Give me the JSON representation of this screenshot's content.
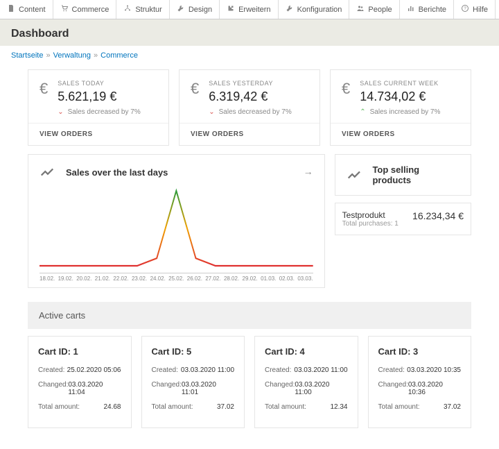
{
  "topnav": [
    {
      "icon": "doc",
      "label": "Content"
    },
    {
      "icon": "cart",
      "label": "Commerce"
    },
    {
      "icon": "tree",
      "label": "Struktur"
    },
    {
      "icon": "wrench",
      "label": "Design"
    },
    {
      "icon": "puzzle",
      "label": "Erweitern"
    },
    {
      "icon": "wrench",
      "label": "Konfiguration"
    },
    {
      "icon": "people",
      "label": "People"
    },
    {
      "icon": "bars",
      "label": "Berichte"
    },
    {
      "icon": "help",
      "label": "Hilfe"
    }
  ],
  "page_title": "Dashboard",
  "breadcrumb": [
    "Startseite",
    "Verwaltung",
    "Commerce"
  ],
  "stats": [
    {
      "label": "SALES TODAY",
      "value": "5.621,19 €",
      "delta_dir": "down",
      "delta_text": "Sales decreased by 7%",
      "footer": "VIEW ORDERS"
    },
    {
      "label": "SALES YESTERDAY",
      "value": "6.319,42 €",
      "delta_dir": "down",
      "delta_text": "Sales decreased by 7%",
      "footer": "VIEW ORDERS"
    },
    {
      "label": "SALES CURRENT WEEK",
      "value": "14.734,02 €",
      "delta_dir": "up",
      "delta_text": "Sales increased by 7%",
      "footer": "VIEW ORDERS"
    }
  ],
  "chart_title": "Sales over the last days",
  "products_title": "Top selling products",
  "products": [
    {
      "name": "Testprodukt",
      "sub": "Total purchases: 1",
      "price": "16.234,34 €"
    }
  ],
  "active_carts_title": "Active carts",
  "carts": [
    {
      "title": "Cart ID: 1",
      "created": "25.02.2020 05:06",
      "changed": "03.03.2020 11:04",
      "total": "24.68"
    },
    {
      "title": "Cart ID: 5",
      "created": "03.03.2020 11:00",
      "changed": "03.03.2020 11:01",
      "total": "37.02"
    },
    {
      "title": "Cart ID: 4",
      "created": "03.03.2020 11:00",
      "changed": "03.03.2020 11:00",
      "total": "12.34"
    },
    {
      "title": "Cart ID: 3",
      "created": "03.03.2020 10:35",
      "changed": "03.03.2020 10:36",
      "total": "37.02"
    }
  ],
  "cart_labels": {
    "created": "Created:",
    "changed": "Changed:",
    "total": "Total amount:"
  },
  "chart_data": {
    "type": "line",
    "title": "Sales over the last days",
    "categories": [
      "18.02.",
      "19.02.",
      "20.02.",
      "21.02.",
      "22.02.",
      "23.02.",
      "24.02.",
      "25.02.",
      "26.02.",
      "27.02.",
      "28.02.",
      "29.02.",
      "01.03.",
      "02.03.",
      "03.03."
    ],
    "values": [
      0,
      0,
      0,
      0,
      0,
      0,
      10,
      100,
      10,
      0,
      0,
      0,
      0,
      0,
      0
    ],
    "xlabel": "",
    "ylabel": "",
    "ylim": [
      0,
      100
    ]
  }
}
